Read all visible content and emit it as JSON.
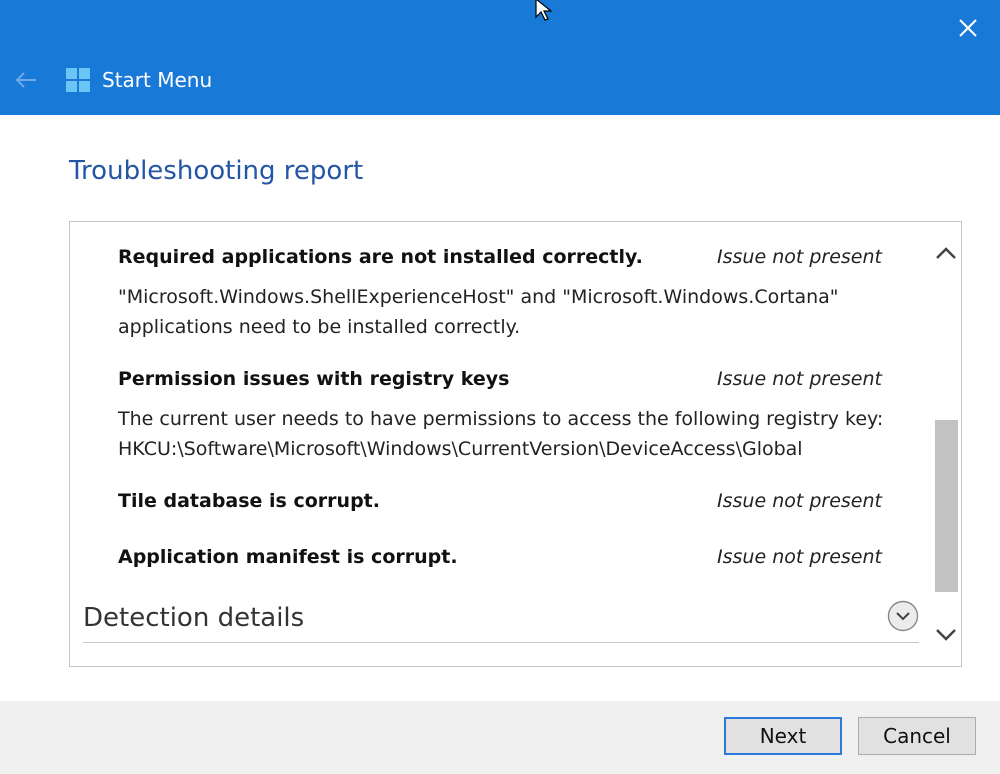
{
  "window": {
    "app_title": "Start Menu",
    "title_bar_color": "#1979d6"
  },
  "page": {
    "title": "Troubleshooting report"
  },
  "issues": [
    {
      "title": "Required applications are not installed correctly.",
      "status": "Issue not present",
      "description_lines": [
        "\"Microsoft.Windows.ShellExperienceHost\" and \"Microsoft.Windows.Cortana\"",
        "applications need to be installed correctly."
      ]
    },
    {
      "title": "Permission issues with registry keys",
      "status": "Issue not present",
      "description_lines": [
        "The current user needs to have permissions to access the following registry key:",
        "HKCU:\\Software\\Microsoft\\Windows\\CurrentVersion\\DeviceAccess\\Global"
      ]
    },
    {
      "title": "Tile database is corrupt.",
      "status": "Issue not present",
      "description_lines": []
    },
    {
      "title": "Application manifest is corrupt.",
      "status": "Issue not present",
      "description_lines": []
    }
  ],
  "detection": {
    "label": "Detection details"
  },
  "buttons": {
    "next": "Next",
    "cancel": "Cancel"
  },
  "icons": {
    "close": "close-icon",
    "back": "back-arrow-icon",
    "logo": "windows-logo-icon",
    "expand": "chevron-down-circle-icon",
    "scroll_up": "chevron-up-icon",
    "scroll_down": "chevron-down-icon"
  }
}
